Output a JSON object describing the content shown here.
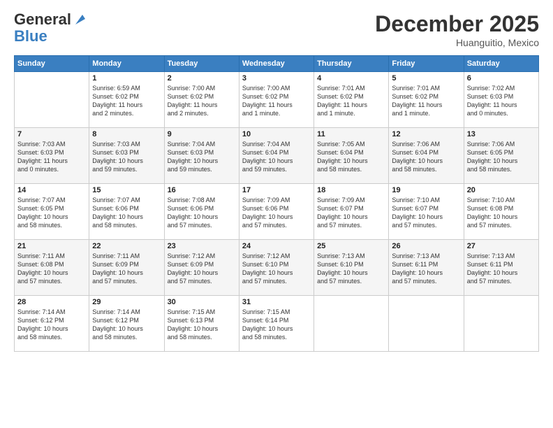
{
  "header": {
    "logo_general": "General",
    "logo_blue": "Blue",
    "month_title": "December 2025",
    "subtitle": "Huanguitio, Mexico"
  },
  "days_of_week": [
    "Sunday",
    "Monday",
    "Tuesday",
    "Wednesday",
    "Thursday",
    "Friday",
    "Saturday"
  ],
  "weeks": [
    [
      {
        "day": "",
        "info": ""
      },
      {
        "day": "1",
        "info": "Sunrise: 6:59 AM\nSunset: 6:02 PM\nDaylight: 11 hours\nand 2 minutes."
      },
      {
        "day": "2",
        "info": "Sunrise: 7:00 AM\nSunset: 6:02 PM\nDaylight: 11 hours\nand 2 minutes."
      },
      {
        "day": "3",
        "info": "Sunrise: 7:00 AM\nSunset: 6:02 PM\nDaylight: 11 hours\nand 1 minute."
      },
      {
        "day": "4",
        "info": "Sunrise: 7:01 AM\nSunset: 6:02 PM\nDaylight: 11 hours\nand 1 minute."
      },
      {
        "day": "5",
        "info": "Sunrise: 7:01 AM\nSunset: 6:02 PM\nDaylight: 11 hours\nand 1 minute."
      },
      {
        "day": "6",
        "info": "Sunrise: 7:02 AM\nSunset: 6:03 PM\nDaylight: 11 hours\nand 0 minutes."
      }
    ],
    [
      {
        "day": "7",
        "info": "Sunrise: 7:03 AM\nSunset: 6:03 PM\nDaylight: 11 hours\nand 0 minutes."
      },
      {
        "day": "8",
        "info": "Sunrise: 7:03 AM\nSunset: 6:03 PM\nDaylight: 10 hours\nand 59 minutes."
      },
      {
        "day": "9",
        "info": "Sunrise: 7:04 AM\nSunset: 6:03 PM\nDaylight: 10 hours\nand 59 minutes."
      },
      {
        "day": "10",
        "info": "Sunrise: 7:04 AM\nSunset: 6:04 PM\nDaylight: 10 hours\nand 59 minutes."
      },
      {
        "day": "11",
        "info": "Sunrise: 7:05 AM\nSunset: 6:04 PM\nDaylight: 10 hours\nand 58 minutes."
      },
      {
        "day": "12",
        "info": "Sunrise: 7:06 AM\nSunset: 6:04 PM\nDaylight: 10 hours\nand 58 minutes."
      },
      {
        "day": "13",
        "info": "Sunrise: 7:06 AM\nSunset: 6:05 PM\nDaylight: 10 hours\nand 58 minutes."
      }
    ],
    [
      {
        "day": "14",
        "info": "Sunrise: 7:07 AM\nSunset: 6:05 PM\nDaylight: 10 hours\nand 58 minutes."
      },
      {
        "day": "15",
        "info": "Sunrise: 7:07 AM\nSunset: 6:06 PM\nDaylight: 10 hours\nand 58 minutes."
      },
      {
        "day": "16",
        "info": "Sunrise: 7:08 AM\nSunset: 6:06 PM\nDaylight: 10 hours\nand 57 minutes."
      },
      {
        "day": "17",
        "info": "Sunrise: 7:09 AM\nSunset: 6:06 PM\nDaylight: 10 hours\nand 57 minutes."
      },
      {
        "day": "18",
        "info": "Sunrise: 7:09 AM\nSunset: 6:07 PM\nDaylight: 10 hours\nand 57 minutes."
      },
      {
        "day": "19",
        "info": "Sunrise: 7:10 AM\nSunset: 6:07 PM\nDaylight: 10 hours\nand 57 minutes."
      },
      {
        "day": "20",
        "info": "Sunrise: 7:10 AM\nSunset: 6:08 PM\nDaylight: 10 hours\nand 57 minutes."
      }
    ],
    [
      {
        "day": "21",
        "info": "Sunrise: 7:11 AM\nSunset: 6:08 PM\nDaylight: 10 hours\nand 57 minutes."
      },
      {
        "day": "22",
        "info": "Sunrise: 7:11 AM\nSunset: 6:09 PM\nDaylight: 10 hours\nand 57 minutes."
      },
      {
        "day": "23",
        "info": "Sunrise: 7:12 AM\nSunset: 6:09 PM\nDaylight: 10 hours\nand 57 minutes."
      },
      {
        "day": "24",
        "info": "Sunrise: 7:12 AM\nSunset: 6:10 PM\nDaylight: 10 hours\nand 57 minutes."
      },
      {
        "day": "25",
        "info": "Sunrise: 7:13 AM\nSunset: 6:10 PM\nDaylight: 10 hours\nand 57 minutes."
      },
      {
        "day": "26",
        "info": "Sunrise: 7:13 AM\nSunset: 6:11 PM\nDaylight: 10 hours\nand 57 minutes."
      },
      {
        "day": "27",
        "info": "Sunrise: 7:13 AM\nSunset: 6:11 PM\nDaylight: 10 hours\nand 57 minutes."
      }
    ],
    [
      {
        "day": "28",
        "info": "Sunrise: 7:14 AM\nSunset: 6:12 PM\nDaylight: 10 hours\nand 58 minutes."
      },
      {
        "day": "29",
        "info": "Sunrise: 7:14 AM\nSunset: 6:12 PM\nDaylight: 10 hours\nand 58 minutes."
      },
      {
        "day": "30",
        "info": "Sunrise: 7:15 AM\nSunset: 6:13 PM\nDaylight: 10 hours\nand 58 minutes."
      },
      {
        "day": "31",
        "info": "Sunrise: 7:15 AM\nSunset: 6:14 PM\nDaylight: 10 hours\nand 58 minutes."
      },
      {
        "day": "",
        "info": ""
      },
      {
        "day": "",
        "info": ""
      },
      {
        "day": "",
        "info": ""
      }
    ]
  ]
}
